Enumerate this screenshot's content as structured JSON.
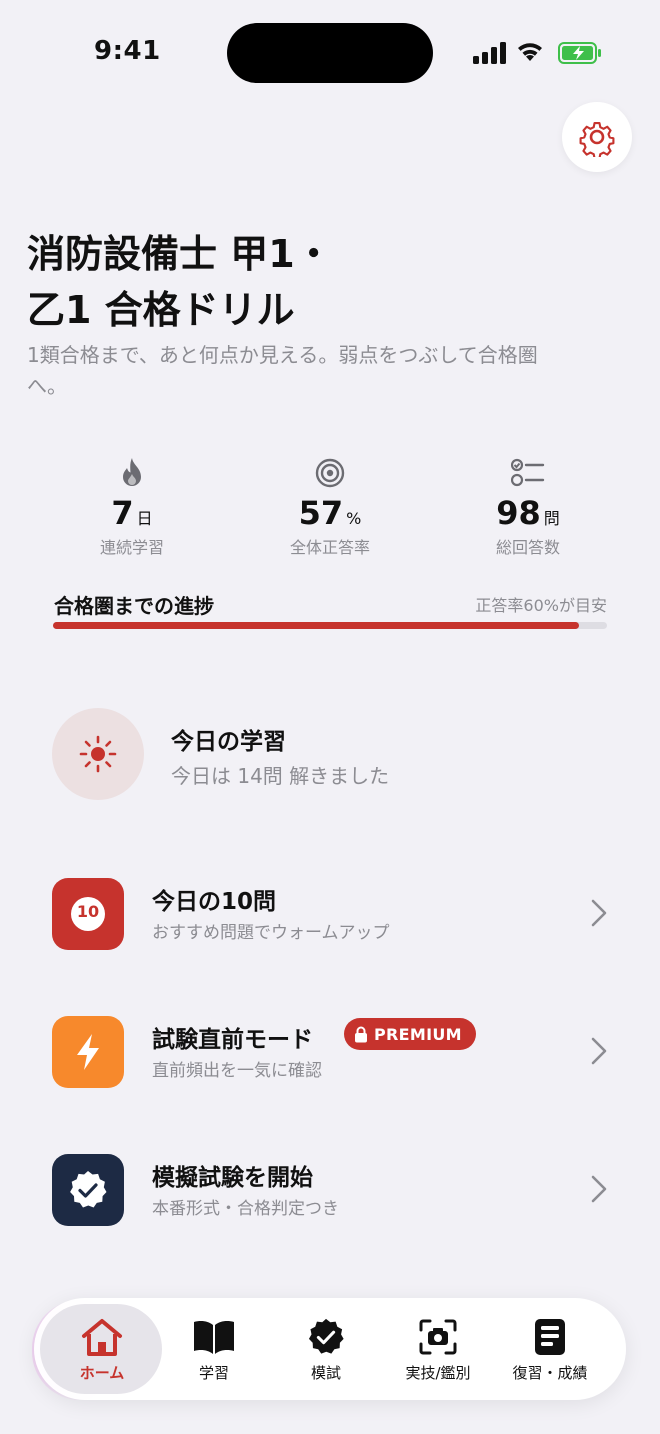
{
  "status_bar": {
    "time": "9:41"
  },
  "header": {
    "title_line1": "消防設備士 甲1・",
    "title_line2": "乙1 合格ドリル",
    "subtitle": "1類合格まで、あと何点か見える。弱点をつぶして合格圏へ。"
  },
  "stats": [
    {
      "icon": "flame-icon",
      "value": "7",
      "unit": "日",
      "label": "連続学習"
    },
    {
      "icon": "target-icon",
      "value": "57",
      "unit": "%",
      "label": "全体正答率"
    },
    {
      "icon": "checklist-icon",
      "value": "98",
      "unit": "問",
      "label": "総回答数"
    }
  ],
  "progress": {
    "label": "合格圏までの進捗",
    "hint": "正答率60%が目安",
    "fraction": 0.95,
    "color": "#c6332d"
  },
  "today": {
    "title": "今日の学習",
    "subtitle": "今日は 14問 解きました",
    "icon": "sun-icon"
  },
  "menu": [
    {
      "title": "今日の10問",
      "subtitle": "おすすめ問題でウォームアップ",
      "icon": "ten-badge-icon",
      "badge_text": "10",
      "color": "#c6332d"
    },
    {
      "title": "試験直前モード",
      "subtitle": "直前頻出を一気に確認",
      "icon": "lightning-icon",
      "color": "#f7892c",
      "badge": "PREMIUM"
    },
    {
      "title": "模擬試験を開始",
      "subtitle": "本番形式・合格判定つき",
      "icon": "verified-check-icon",
      "color": "#1d2a44"
    }
  ],
  "tabs": [
    {
      "label": "ホーム",
      "icon": "home-icon",
      "active": true
    },
    {
      "label": "学習",
      "icon": "book-icon",
      "active": false
    },
    {
      "label": "模試",
      "icon": "verified-check-icon",
      "active": false
    },
    {
      "label": "実技/鑑別",
      "icon": "camera-icon",
      "active": false
    },
    {
      "label": "復習・成績",
      "icon": "document-icon",
      "active": false
    }
  ],
  "colors": {
    "accent": "#c6332d",
    "background": "#f2f1f6",
    "muted": "#8c8c92"
  }
}
